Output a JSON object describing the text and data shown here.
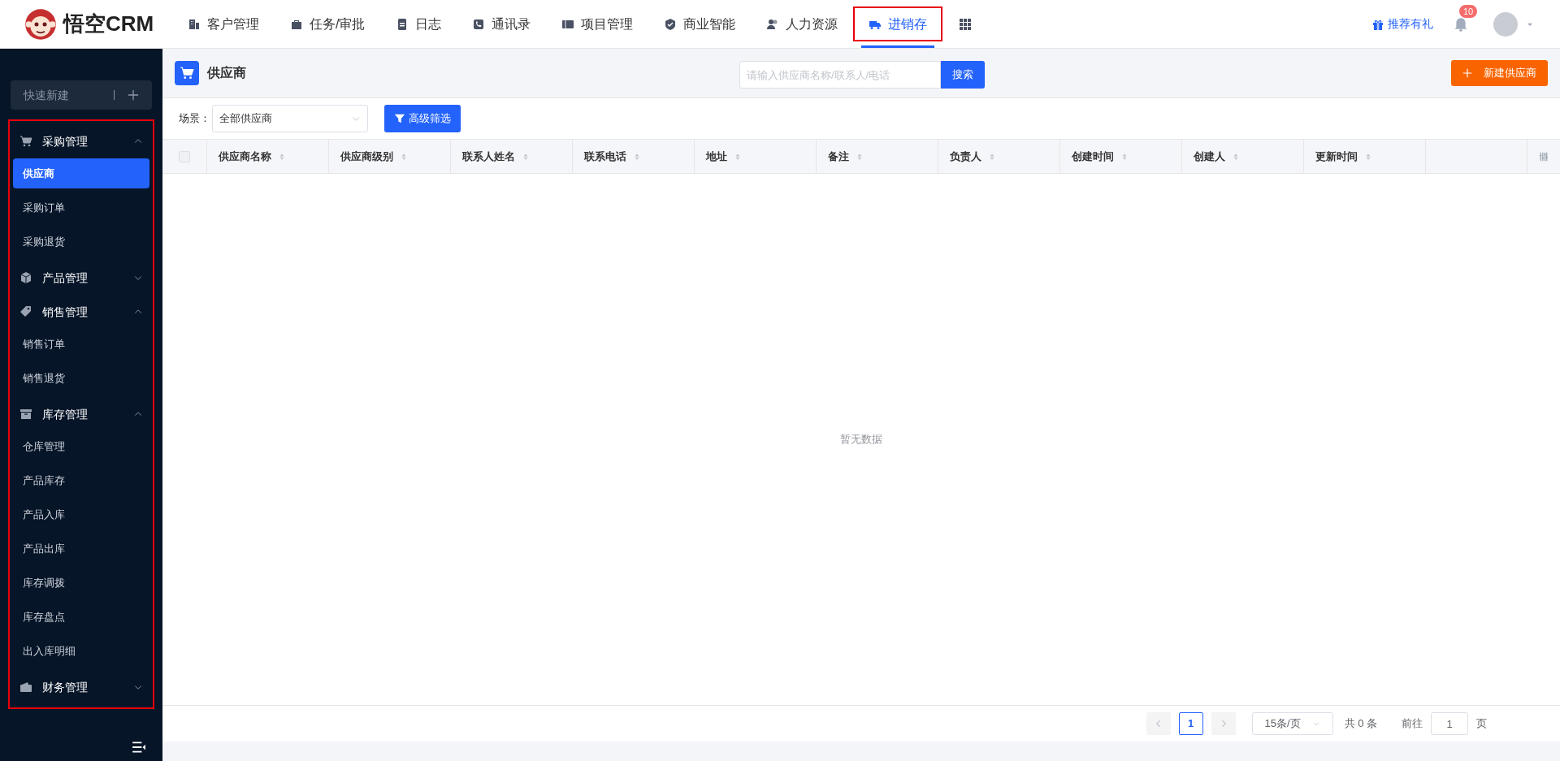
{
  "brand": {
    "name": "悟空CRM"
  },
  "nav": [
    {
      "label": "客户管理",
      "selected": false,
      "highlighted": false
    },
    {
      "label": "任务/审批",
      "selected": false,
      "highlighted": false
    },
    {
      "label": "日志",
      "selected": false,
      "highlighted": false
    },
    {
      "label": "通讯录",
      "selected": false,
      "highlighted": false
    },
    {
      "label": "项目管理",
      "selected": false,
      "highlighted": false
    },
    {
      "label": "商业智能",
      "selected": false,
      "highlighted": false
    },
    {
      "label": "人力资源",
      "selected": false,
      "highlighted": false
    },
    {
      "label": "进销存",
      "selected": true,
      "highlighted": true
    }
  ],
  "header_right": {
    "gift_link": "推荐有礼",
    "notification_count": "10"
  },
  "sidebar": {
    "quick_create": "快速新建",
    "highlighted": true,
    "groups": [
      {
        "label": "采购管理",
        "expanded": true,
        "children": [
          {
            "label": "供应商",
            "selected": true
          },
          {
            "label": "采购订单",
            "selected": false
          },
          {
            "label": "采购退货",
            "selected": false
          }
        ]
      },
      {
        "label": "产品管理",
        "expanded": false
      },
      {
        "label": "销售管理",
        "expanded": true,
        "children": [
          {
            "label": "销售订单",
            "selected": false
          },
          {
            "label": "销售退货",
            "selected": false
          }
        ]
      },
      {
        "label": "库存管理",
        "expanded": true,
        "children": [
          {
            "label": "仓库管理",
            "selected": false
          },
          {
            "label": "产品库存",
            "selected": false
          },
          {
            "label": "产品入库",
            "selected": false
          },
          {
            "label": "产品出库",
            "selected": false
          },
          {
            "label": "库存调拨",
            "selected": false
          },
          {
            "label": "库存盘点",
            "selected": false
          },
          {
            "label": "出入库明细",
            "selected": false
          }
        ]
      },
      {
        "label": "财务管理",
        "expanded": false
      }
    ]
  },
  "page": {
    "title": "供应商",
    "search_placeholder": "请输入供应商名称/联系人/电话",
    "search_button": "搜索",
    "new_button": "新建供应商"
  },
  "filter": {
    "scene_label": "场景：",
    "scene_value": "全部供应商",
    "advanced_button": "高级筛选"
  },
  "table": {
    "select_all_checked": false,
    "columns": [
      "供应商名称",
      "供应商级别",
      "联系人姓名",
      "联系电话",
      "地址",
      "备注",
      "负责人",
      "创建时间",
      "创建人",
      "更新时间"
    ],
    "empty_text": "暂无数据"
  },
  "pagination": {
    "current_page": "1",
    "page_size": "15条/页",
    "total": "共 0 条",
    "goto_label": "前往",
    "goto_value": "1",
    "page_suffix": "页"
  }
}
